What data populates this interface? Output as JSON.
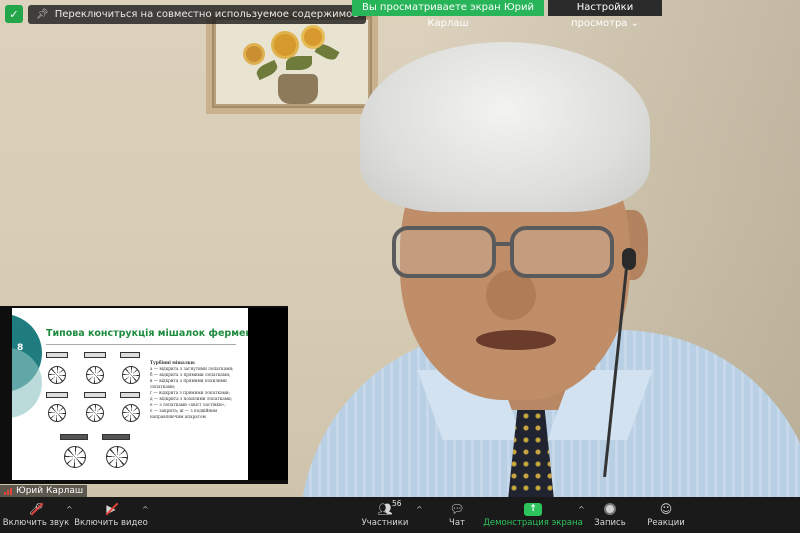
{
  "topbar": {
    "notice_text": "Переключиться на совместно используемое содержимое",
    "share_banner": "Вы просматриваете экран Юрий Карлаш",
    "view_options": "Настройки просмотра"
  },
  "slide": {
    "number": "8",
    "title": "Типова конструкція мішалок ферментера",
    "text_heading": "Турбінні мішалки:",
    "text_lines": [
      "а — відкрита з загнутими лопатками;",
      "б — відкрита з прямими лопатками;",
      "в — відкрита з прямими похилими лопатками;",
      "г — відкрита з прямими лопатками;",
      "д — відкрита з похилими лопатками;",
      "е — з лопатками «хвіст ластівки»;",
      "є — закрита; ж — з подвійним направляючим апаратом"
    ]
  },
  "participant": {
    "name": "Юрий Карлаш"
  },
  "toolbar": {
    "mute_label": "Включить звук",
    "video_label": "Включить видео",
    "participants_label": "Участники",
    "participants_count": "56",
    "chat_label": "Чат",
    "share_label": "Демонстрация экрана",
    "record_label": "Запись",
    "reactions_label": "Реакции"
  },
  "colors": {
    "share_banner_bg": "#28b458",
    "accent_green": "#2ec45d",
    "slide_title": "#1e8c3e",
    "mute_red": "#e0443a"
  }
}
